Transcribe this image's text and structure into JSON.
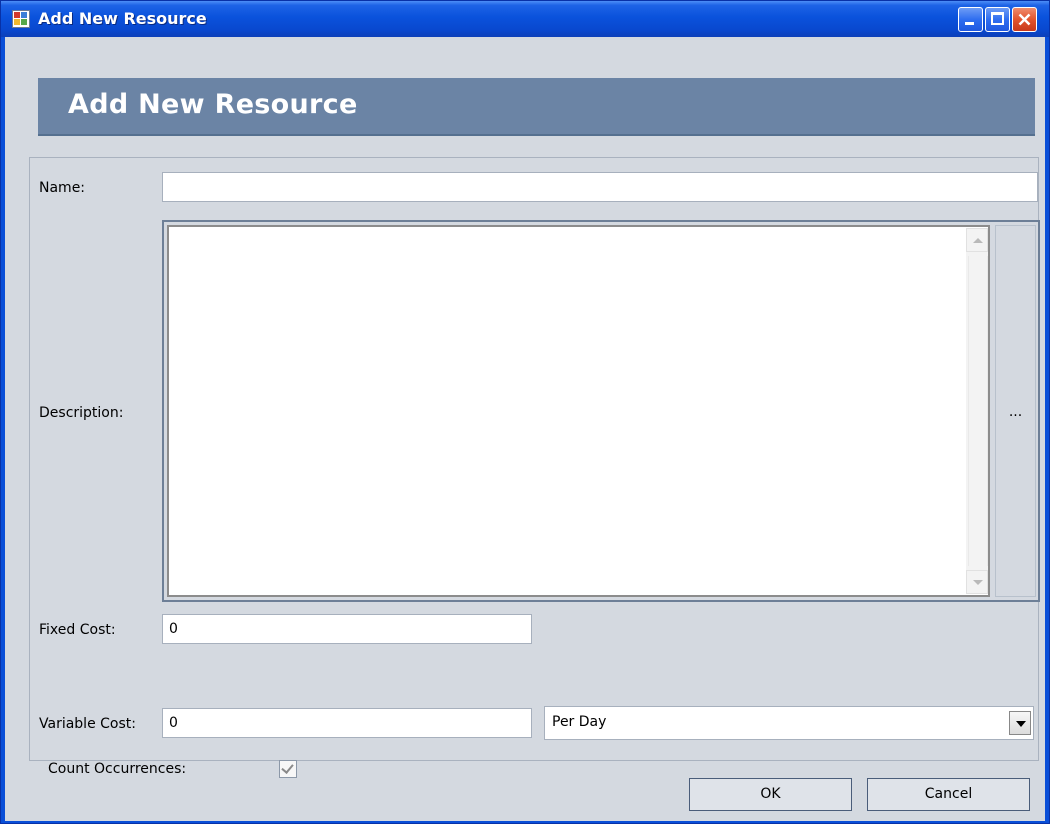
{
  "window": {
    "title": "Add New Resource",
    "controls": {
      "minimize_icon": "minimize-icon",
      "maximize_icon": "maximize-icon",
      "close_icon": "close-icon"
    }
  },
  "header": {
    "title": "Add New Resource"
  },
  "form": {
    "name": {
      "label": "Name:",
      "value": ""
    },
    "description": {
      "label": "Description:",
      "value": "",
      "browse_button_label": "..."
    },
    "fixed_cost": {
      "label": "Fixed Cost:",
      "value": "0"
    },
    "variable_cost": {
      "label": "Variable Cost:",
      "value": "0",
      "unit_selected": "Per Day"
    },
    "count_occurrences": {
      "label": "Count Occurrences:",
      "checked": true
    }
  },
  "buttons": {
    "ok_label": "OK",
    "cancel_label": "Cancel"
  },
  "colors": {
    "titlebar": "#0a52dc",
    "client_background": "#d4d9e0",
    "header_band": "#6b84a5"
  }
}
